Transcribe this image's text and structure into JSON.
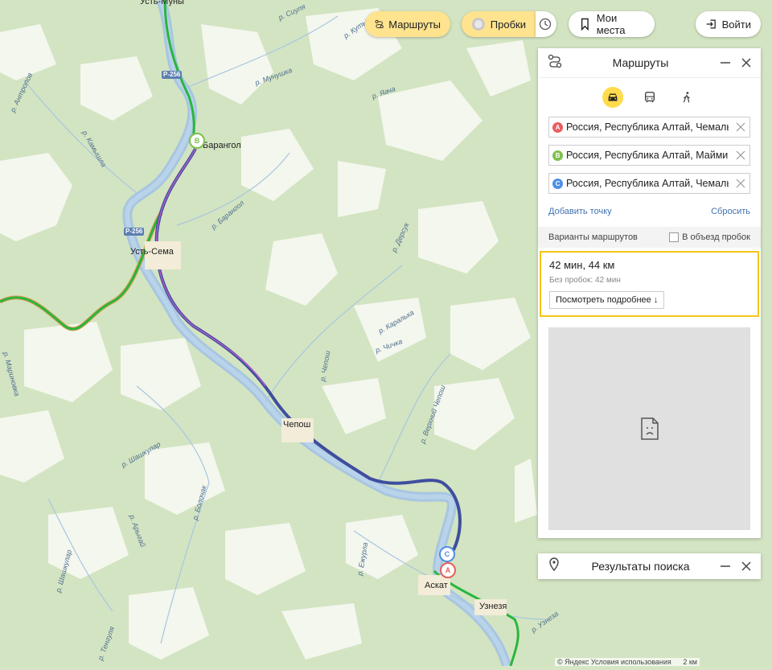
{
  "topbar": {
    "routes_label": "Маршруты",
    "traffic_label": "Пробки",
    "my_places_label": "Мои места",
    "login_label": "Войти"
  },
  "route_panel": {
    "title": "Маршруты",
    "modes": [
      "car-icon",
      "bus-icon",
      "walk-icon"
    ],
    "active_mode": "car",
    "points": [
      {
        "letter": "A",
        "color": "#e85d5d",
        "value": "Россия, Республика Алтай, Чемальский район"
      },
      {
        "letter": "B",
        "color": "#7fc04c",
        "value": "Россия, Республика Алтай, Майминский район"
      },
      {
        "letter": "C",
        "color": "#4d8fe6",
        "value": "Россия, Республика Алтай, Чемальский район"
      }
    ],
    "add_point_label": "Добавить точку",
    "reset_label": "Сбросить",
    "variants_label": "Варианты маршрутов",
    "avoid_traffic_label": "В объезд пробок",
    "variant": {
      "time_distance": "42 мин, 44 км",
      "no_traffic": "Без пробок: 42 мин",
      "details_label": "Посмотреть подробнее ↓"
    }
  },
  "search_panel": {
    "title": "Результаты поиска"
  },
  "map": {
    "towns": [
      "Усть-Муны",
      "Барангол",
      "Усть-Сема",
      "Чепош",
      "Аскат",
      "Узнезя"
    ],
    "rivers": [
      "р. Сиуля",
      "р. Кутьк",
      "р. Мунушка",
      "р. Яача",
      "р. Антропов",
      "р. Камышла",
      "р. Барангол",
      "р. Дерсук",
      "р. Каралька",
      "р. Чепош",
      "р. Чичка",
      "р. Верхний Чепош",
      "р. Шашкулар",
      "р. Болочак",
      "р. Арыгай",
      "р. Ежурла",
      "р. Шашкулар",
      "р. Тенгуля",
      "р. Узнеза",
      "р. Мариновка"
    ],
    "road_label": "Р-256",
    "accent_route": "#3f4e9e",
    "traffic_green": "#2ab63c"
  },
  "footer": {
    "copyright": "© Яндекс Условия использования",
    "scale": "2 км"
  }
}
